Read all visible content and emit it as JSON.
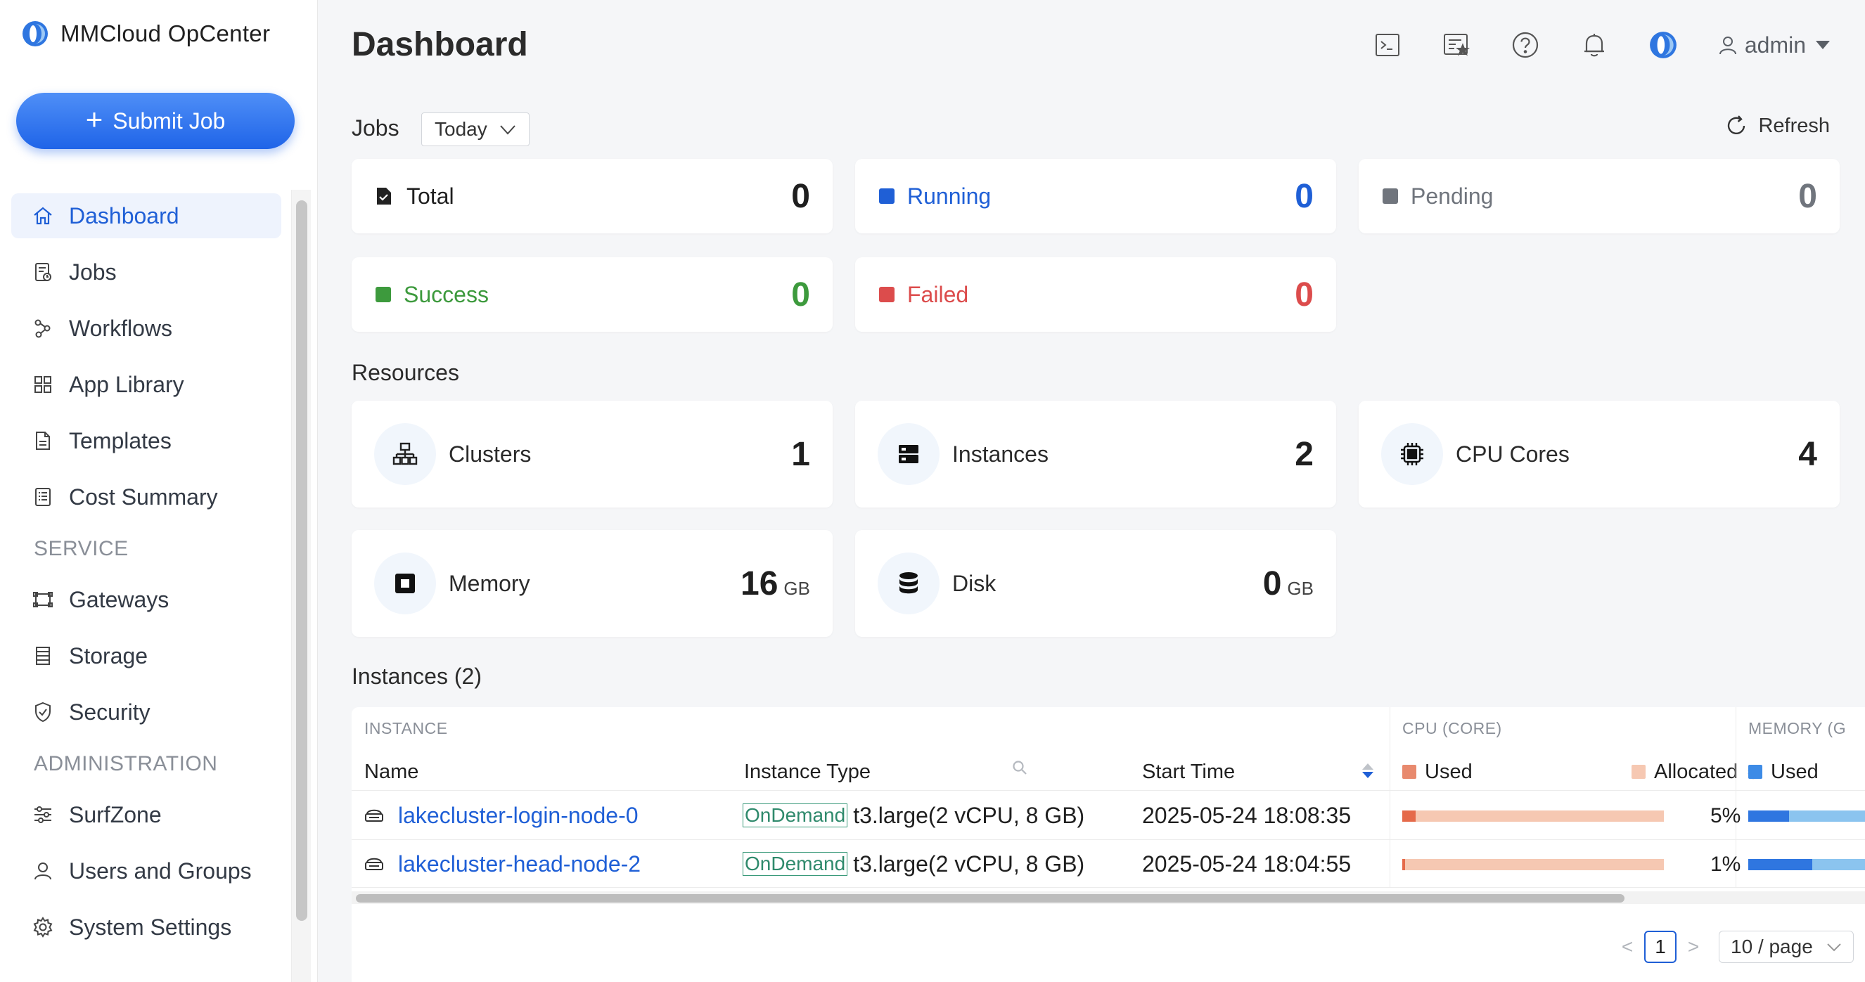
{
  "app": {
    "name": "MMCloud OpCenter",
    "submit_label": "Submit Job"
  },
  "sidebar": {
    "main_items": [
      {
        "label": "Dashboard",
        "icon": "home-icon",
        "active": true
      },
      {
        "label": "Jobs",
        "icon": "jobs-icon"
      },
      {
        "label": "Workflows",
        "icon": "workflow-icon"
      },
      {
        "label": "App Library",
        "icon": "grid-icon"
      },
      {
        "label": "Templates",
        "icon": "document-icon"
      },
      {
        "label": "Cost Summary",
        "icon": "receipt-icon"
      }
    ],
    "service_title": "SERVICE",
    "service_items": [
      {
        "label": "Gateways",
        "icon": "gateway-icon"
      },
      {
        "label": "Storage",
        "icon": "storage-icon"
      },
      {
        "label": "Security",
        "icon": "shield-icon"
      }
    ],
    "admin_title": "ADMINISTRATION",
    "admin_items": [
      {
        "label": "SurfZone",
        "icon": "sliders-icon"
      },
      {
        "label": "Users and Groups",
        "icon": "user-icon"
      },
      {
        "label": "System Settings",
        "icon": "gear-icon"
      }
    ]
  },
  "header": {
    "title": "Dashboard",
    "user_name": "admin"
  },
  "jobs": {
    "label": "Jobs",
    "period": "Today",
    "refresh_label": "Refresh",
    "stats": {
      "total": {
        "label": "Total",
        "value": "0"
      },
      "running": {
        "label": "Running",
        "value": "0"
      },
      "pending": {
        "label": "Pending",
        "value": "0"
      },
      "success": {
        "label": "Success",
        "value": "0"
      },
      "failed": {
        "label": "Failed",
        "value": "0"
      }
    }
  },
  "resources": {
    "label": "Resources",
    "clusters": {
      "label": "Clusters",
      "value": "1"
    },
    "instances": {
      "label": "Instances",
      "value": "2"
    },
    "cpu": {
      "label": "CPU Cores",
      "value": "4"
    },
    "memory": {
      "label": "Memory",
      "value": "16",
      "unit": "GB"
    },
    "disk": {
      "label": "Disk",
      "value": "0",
      "unit": "GB"
    }
  },
  "instances_table": {
    "title": "Instances (2)",
    "group_instance": "INSTANCE",
    "group_cpu": "CPU (CORE)",
    "group_memory": "MEMORY (G",
    "col_name": "Name",
    "col_type": "Instance Type",
    "col_start": "Start Time",
    "col_cpu_used": "Used",
    "col_cpu_alloc": "Allocated",
    "col_mem_used": "Used",
    "rows": [
      {
        "name": "lakecluster-login-node-0",
        "tag": "OnDemand",
        "type": "t3.large(2 vCPU, 8 GB)",
        "start": "2025-05-24 18:08:35",
        "cpu_pct_label": "5%",
        "cpu_pct": 5,
        "mem_pct": 35
      },
      {
        "name": "lakecluster-head-node-2",
        "tag": "OnDemand",
        "type": "t3.large(2 vCPU, 8 GB)",
        "start": "2025-05-24 18:04:55",
        "cpu_pct_label": "1%",
        "cpu_pct": 1,
        "mem_pct": 55
      }
    ],
    "pagination": {
      "page": "1",
      "page_size": "10 / page",
      "prev": "<",
      "next": ">"
    }
  },
  "colors": {
    "accent": "#1f5fd6",
    "running": "#1f5fd6",
    "pending": "#70757d",
    "success": "#3d9a3d",
    "failed": "#dc4c4c",
    "cpu_used": "#e56a4a",
    "cpu_allocated": "#f6c8b2",
    "mem_used": "#2f76e0"
  }
}
